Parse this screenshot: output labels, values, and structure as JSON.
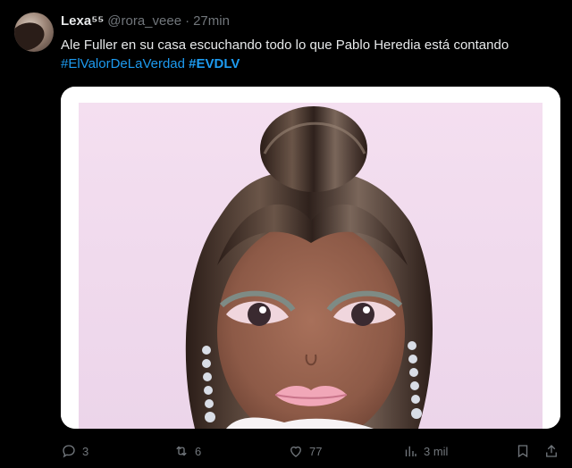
{
  "tweet": {
    "author_name": "Lexa⁵⁵",
    "handle": "@rora_veee",
    "separator": "·",
    "time": "27min",
    "text": "Ale Fuller en su casa escuchando todo lo que Pablo Heredia está contando",
    "hashtags": [
      "#ElValorDeLaVerdad",
      "#EVDLV"
    ]
  },
  "actions": {
    "reply_count": "3",
    "retweet_count": "6",
    "like_count": "77",
    "views_count": "3 mil"
  },
  "icons": {
    "reply": "reply-icon",
    "retweet": "retweet-icon",
    "like": "heart-icon",
    "views": "views-chart-icon",
    "bookmark": "bookmark-icon",
    "share": "share-icon"
  },
  "colors": {
    "background": "#000000",
    "text": "#e7e9ea",
    "muted": "#71767b",
    "link": "#1d9bf0"
  }
}
